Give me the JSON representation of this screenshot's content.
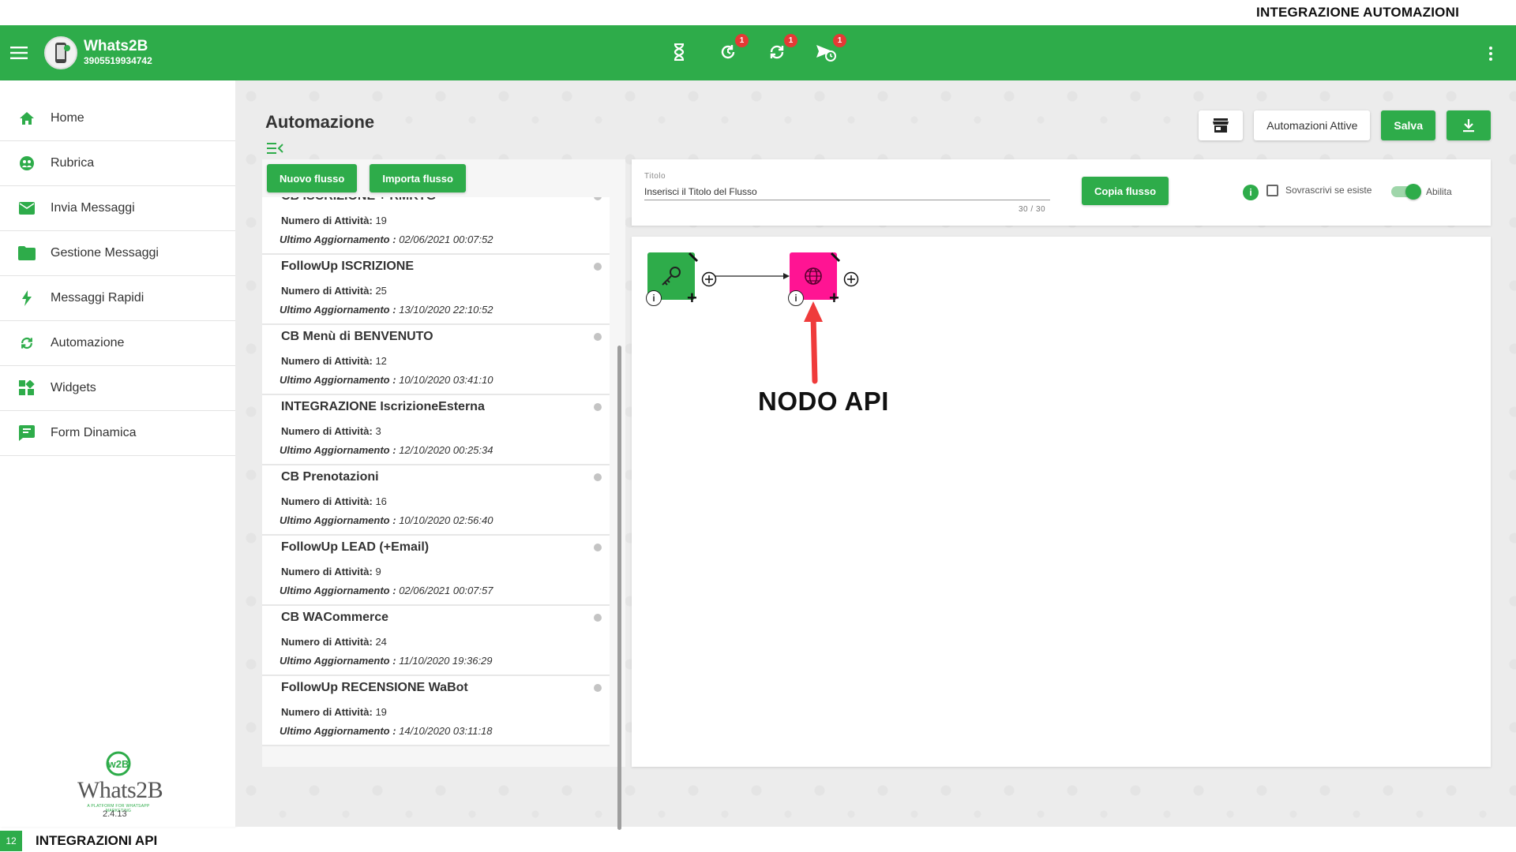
{
  "slide": {
    "top_title": "INTEGRAZIONE AUTOMAZIONI",
    "number": "12",
    "bottom_title": "INTEGRAZIONI API"
  },
  "header": {
    "app_name": "Whats2B",
    "phone": "3905519934742",
    "icons": [
      {
        "name": "hourglass-icon",
        "badge": ""
      },
      {
        "name": "history-icon",
        "badge": "1"
      },
      {
        "name": "sync-icon",
        "badge": "1"
      },
      {
        "name": "send-schedule-icon",
        "badge": "1"
      }
    ],
    "accent_color": "#2eac4a"
  },
  "sidebar": {
    "items": [
      {
        "label": "Home",
        "icon": "home-icon"
      },
      {
        "label": "Rubrica",
        "icon": "contacts-icon"
      },
      {
        "label": "Invia Messaggi",
        "icon": "mail-icon"
      },
      {
        "label": "Gestione Messaggi",
        "icon": "folder-icon"
      },
      {
        "label": "Messaggi Rapidi",
        "icon": "flash-icon"
      },
      {
        "label": "Automazione",
        "icon": "sync-icon"
      },
      {
        "label": "Widgets",
        "icon": "widgets-icon"
      },
      {
        "label": "Form Dinamica",
        "icon": "form-icon"
      }
    ],
    "logo_badge": "w2B",
    "logo_text": "Whats2B",
    "logo_tagline": "A PLATFORM FOR WHATSAPP MARKETING",
    "version": "2.4.13"
  },
  "main": {
    "title": "Automazione",
    "toolbar": {
      "active_label": "Automazioni Attive",
      "save_label": "Salva"
    },
    "list_actions": {
      "new_label": "Nuovo flusso",
      "import_label": "Importa flusso"
    },
    "flows": [
      {
        "title": "CB ISCRIZIONE + RMKTG",
        "count_label": "Numero di Attività:",
        "count": "19",
        "updated_label": "Ultimo Aggiornamento :",
        "updated": "02/06/2021 00:07:52"
      },
      {
        "title": "FollowUp ISCRIZIONE",
        "count_label": "Numero di Attività:",
        "count": "25",
        "updated_label": "Ultimo Aggiornamento :",
        "updated": "13/10/2020 22:10:52"
      },
      {
        "title": "CB Menù di BENVENUTO",
        "count_label": "Numero di Attività:",
        "count": "12",
        "updated_label": "Ultimo Aggiornamento :",
        "updated": "10/10/2020 03:41:10"
      },
      {
        "title": "INTEGRAZIONE IscrizioneEsterna",
        "count_label": "Numero di Attività:",
        "count": "3",
        "updated_label": "Ultimo Aggiornamento :",
        "updated": "12/10/2020 00:25:34"
      },
      {
        "title": "CB Prenotazioni",
        "count_label": "Numero di Attività:",
        "count": "16",
        "updated_label": "Ultimo Aggiornamento :",
        "updated": "10/10/2020 02:56:40"
      },
      {
        "title": "FollowUp LEAD (+Email)",
        "count_label": "Numero di Attività:",
        "count": "9",
        "updated_label": "Ultimo Aggiornamento :",
        "updated": "02/06/2021 00:07:57"
      },
      {
        "title": "CB WACommerce",
        "count_label": "Numero di Attività:",
        "count": "24",
        "updated_label": "Ultimo Aggiornamento :",
        "updated": "11/10/2020 19:36:29"
      },
      {
        "title": "FollowUp RECENSIONE WaBot",
        "count_label": "Numero di Attività:",
        "count": "19",
        "updated_label": "Ultimo Aggiornamento :",
        "updated": "14/10/2020 03:11:18"
      }
    ],
    "title_field": {
      "label": "Titolo",
      "value": "Inserisci il Titolo del Flusso",
      "counter": "30 / 30"
    },
    "copy_label": "Copia flusso",
    "overwrite_label": "Sovrascrivi se esiste",
    "enable_label": "Abilita",
    "annotation": "NODO API",
    "node_info_glyph": "i",
    "node_plus_glyph": "+"
  }
}
